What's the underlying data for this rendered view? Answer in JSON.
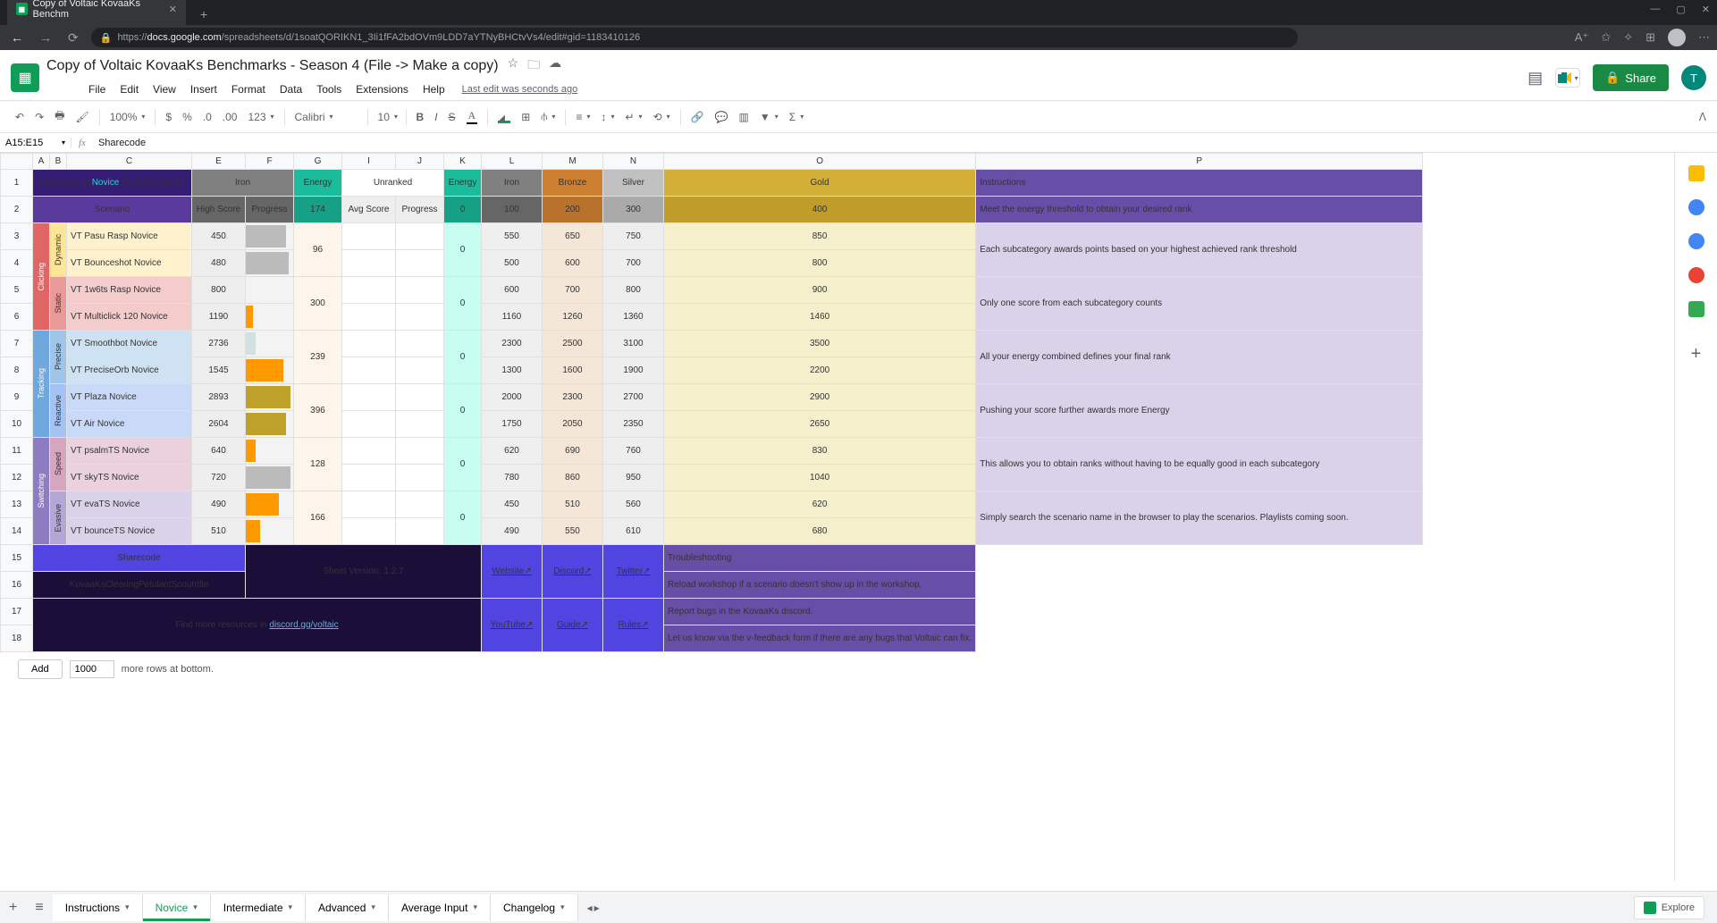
{
  "browser": {
    "tab_title": "Copy of Voltaic KovaaKs Benchm",
    "url_prefix": "https://",
    "url_host": "docs.google.com",
    "url_path": "/spreadsheets/d/1soatQORIKN1_3Ii1fFA2bdOVm9LDD7aYTNyBHCtvVs4/edit#gid=1183410126"
  },
  "doc": {
    "title": "Copy of Voltaic KovaaKs Benchmarks - Season 4 (File -> Make a copy)",
    "share": "Share",
    "user_initial": "T",
    "last_edit": "Last edit was seconds ago"
  },
  "menus": {
    "file": "File",
    "edit": "Edit",
    "view": "View",
    "insert": "Insert",
    "format": "Format",
    "data": "Data",
    "tools": "Tools",
    "extensions": "Extensions",
    "help": "Help"
  },
  "toolbar": {
    "zoom": "100%",
    "font": "Calibri",
    "fontsize": "10",
    "currency": "$",
    "percent": "%",
    "dec_dec": ".0",
    "dec_inc": ".00",
    "numfmt": "123"
  },
  "namebox": "A15:E15",
  "fx": "Sharecode",
  "cols": {
    "A": "A",
    "B": "B",
    "C": "C",
    "E": "E",
    "F": "F",
    "G": "G",
    "I": "I",
    "J": "J",
    "K": "K",
    "L": "L",
    "M": "M",
    "N": "N",
    "O": "O",
    "P": "P"
  },
  "header": {
    "title_prefix": "Voltaic KvKs ",
    "title_mid": "Novice",
    "title_suffix": " Benchmarks S4",
    "iron": "Iron",
    "energy": "Energy",
    "unranked": "Unranked",
    "bronze": "Bronze",
    "silver": "Silver",
    "gold": "Gold",
    "instructions": "Instructions",
    "scenario": "Scenario",
    "highscore": "High Score",
    "progress": "Progress",
    "energy_174": "174",
    "avgscore": "Avg Score",
    "energy_0": "0",
    "v100": "100",
    "v200": "200",
    "v300": "300",
    "v400": "400",
    "instr_sub": "Meet the energy threshold to obtain your desired rank"
  },
  "categories": {
    "clicking": "Clicking",
    "tracking": "Tracking",
    "switching": "Switching"
  },
  "subcats": {
    "dynamic": "Dynamic",
    "static": "Static",
    "precise": "Precise",
    "reactive": "Reactive",
    "speed": "Speed",
    "evasive": "Evasive"
  },
  "rows": [
    {
      "name": "VT Pasu Rasp Novice",
      "hs": "450",
      "prog": 85,
      "pcls": "prog-silver",
      "iron": "550",
      "bronze": "650",
      "silver": "750",
      "gold": "850"
    },
    {
      "name": "VT Bounceshot Novice",
      "hs": "480",
      "prog": 90,
      "pcls": "prog-silver",
      "iron": "500",
      "bronze": "600",
      "silver": "700",
      "gold": "800"
    },
    {
      "name": "VT 1w6ts Rasp Novice",
      "hs": "800",
      "prog": 0,
      "pcls": "",
      "iron": "600",
      "bronze": "700",
      "silver": "800",
      "gold": "900"
    },
    {
      "name": "VT Multiclick 120 Novice",
      "hs": "1190",
      "prog": 15,
      "pcls": "prog-orange",
      "iron": "1160",
      "bronze": "1260",
      "silver": "1360",
      "gold": "1460"
    },
    {
      "name": "VT Smoothbot Novice",
      "hs": "2736",
      "prog": 20,
      "pcls": "prog-lt",
      "iron": "2300",
      "bronze": "2500",
      "silver": "3100",
      "gold": "3500"
    },
    {
      "name": "VT PreciseOrb Novice",
      "hs": "1545",
      "prog": 80,
      "pcls": "prog-orange",
      "iron": "1300",
      "bronze": "1600",
      "silver": "1900",
      "gold": "2200"
    },
    {
      "name": "VT Plaza Novice",
      "hs": "2893",
      "prog": 95,
      "pcls": "prog-gold",
      "iron": "2000",
      "bronze": "2300",
      "silver": "2700",
      "gold": "2900"
    },
    {
      "name": "VT Air Novice",
      "hs": "2604",
      "prog": 85,
      "pcls": "prog-gold",
      "iron": "1750",
      "bronze": "2050",
      "silver": "2350",
      "gold": "2650"
    },
    {
      "name": "VT psalmTS Novice",
      "hs": "640",
      "prog": 20,
      "pcls": "prog-orange",
      "iron": "620",
      "bronze": "690",
      "silver": "760",
      "gold": "830"
    },
    {
      "name": "VT skyTS Novice",
      "hs": "720",
      "prog": 95,
      "pcls": "prog-silver",
      "iron": "780",
      "bronze": "860",
      "silver": "950",
      "gold": "1040"
    },
    {
      "name": "VT evaTS Novice",
      "hs": "490",
      "prog": 70,
      "pcls": "prog-orange",
      "iron": "450",
      "bronze": "510",
      "silver": "560",
      "gold": "620"
    },
    {
      "name": "VT bounceTS Novice",
      "hs": "510",
      "prog": 30,
      "pcls": "prog-orange",
      "iron": "490",
      "bronze": "550",
      "silver": "610",
      "gold": "680"
    }
  ],
  "gvals": {
    "g34": "96",
    "g56": "300",
    "g78": "239",
    "g910": "396",
    "g1112": "128",
    "g1314": "166"
  },
  "kzero": "0",
  "instr": {
    "r34": "Each subcategory awards points based on your highest achieved rank threshold",
    "r56": "Only one score from each subcategory counts",
    "r78": "All your energy combined defines your final rank",
    "r910": "Pushing your score further awards more Energy",
    "r1112": "This allows you to obtain ranks without having to be equally good in each subcategory",
    "r1314": "Simply search the scenario name in the browser to play the scenarios. Playlists coming soon."
  },
  "footer": {
    "sharecode": "Sharecode",
    "sharecode_val": "KovaaKsClearingPetulantScoutrifle",
    "sheet_version": "Sheet Version: 1.2.7",
    "resources_pre": "Find more resources in ",
    "resources_link": "discord.gg/voltaic",
    "website": "Website↗",
    "discord": "Discord↗",
    "twitter": "Twitter↗",
    "youtube": "YouTube↗",
    "guide": "Guide↗",
    "rules": "Rules↗",
    "trouble": "Troubleshooting",
    "t1": "Reload workshop if a scenario doesn't show up in the workshop.",
    "t2": "Report bugs in the KovaaKs discord.",
    "t3": "Let us know via the v-feedback form if there are any bugs that Voltaic can fix."
  },
  "addrows": {
    "add": "Add",
    "count": "1000",
    "suffix": "more rows at bottom."
  },
  "tabs": {
    "instructions": "Instructions",
    "novice": "Novice",
    "intermediate": "Intermediate",
    "advanced": "Advanced",
    "avginput": "Average Input",
    "changelog": "Changelog"
  },
  "explore": "Explore"
}
